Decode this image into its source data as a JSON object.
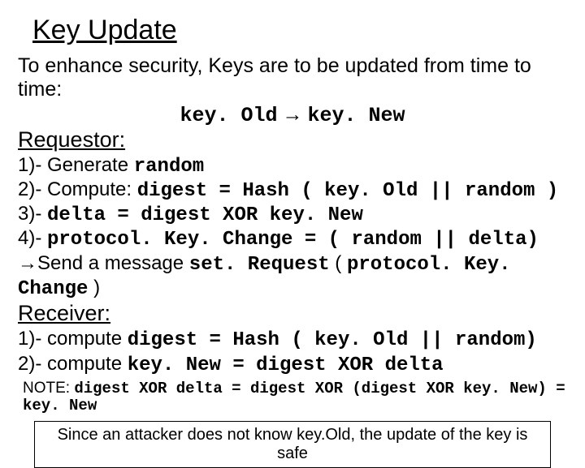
{
  "title": "Key Update",
  "intro": "To enhance security, Keys are to be updated from time to time:",
  "transform": {
    "old": "key. Old",
    "arrow": "→",
    "new": "key. New"
  },
  "requestor": {
    "heading": "Requestor:",
    "s1_a": "1)- Generate ",
    "s1_b": "random",
    "s2_a": "2)- Compute: ",
    "s2_b": "digest = Hash ( key. Old || random )",
    "s3_a": "3)- ",
    "s3_b": "delta = digest XOR key. New",
    "s4_a": "4)- ",
    "s4_b": "protocol. Key. Change = ( random || delta)",
    "s5_arrow": "→",
    "s5_a": "Send a message ",
    "s5_b": "set. Request",
    "s5_c": " ( ",
    "s5_d": "protocol. Key. Change",
    "s5_e": " )"
  },
  "receiver": {
    "heading": "Receiver:",
    "s1_a": "1)- compute ",
    "s1_b": "digest = Hash ( key. Old || random)",
    "s2_a": "2)- compute ",
    "s2_b": "key. New = digest XOR delta"
  },
  "note": {
    "a": "NOTE: ",
    "b": "digest XOR delta = digest XOR (digest XOR key. New) = key. New"
  },
  "callout": "Since an attacker does not know key.Old, the update of the key is safe"
}
